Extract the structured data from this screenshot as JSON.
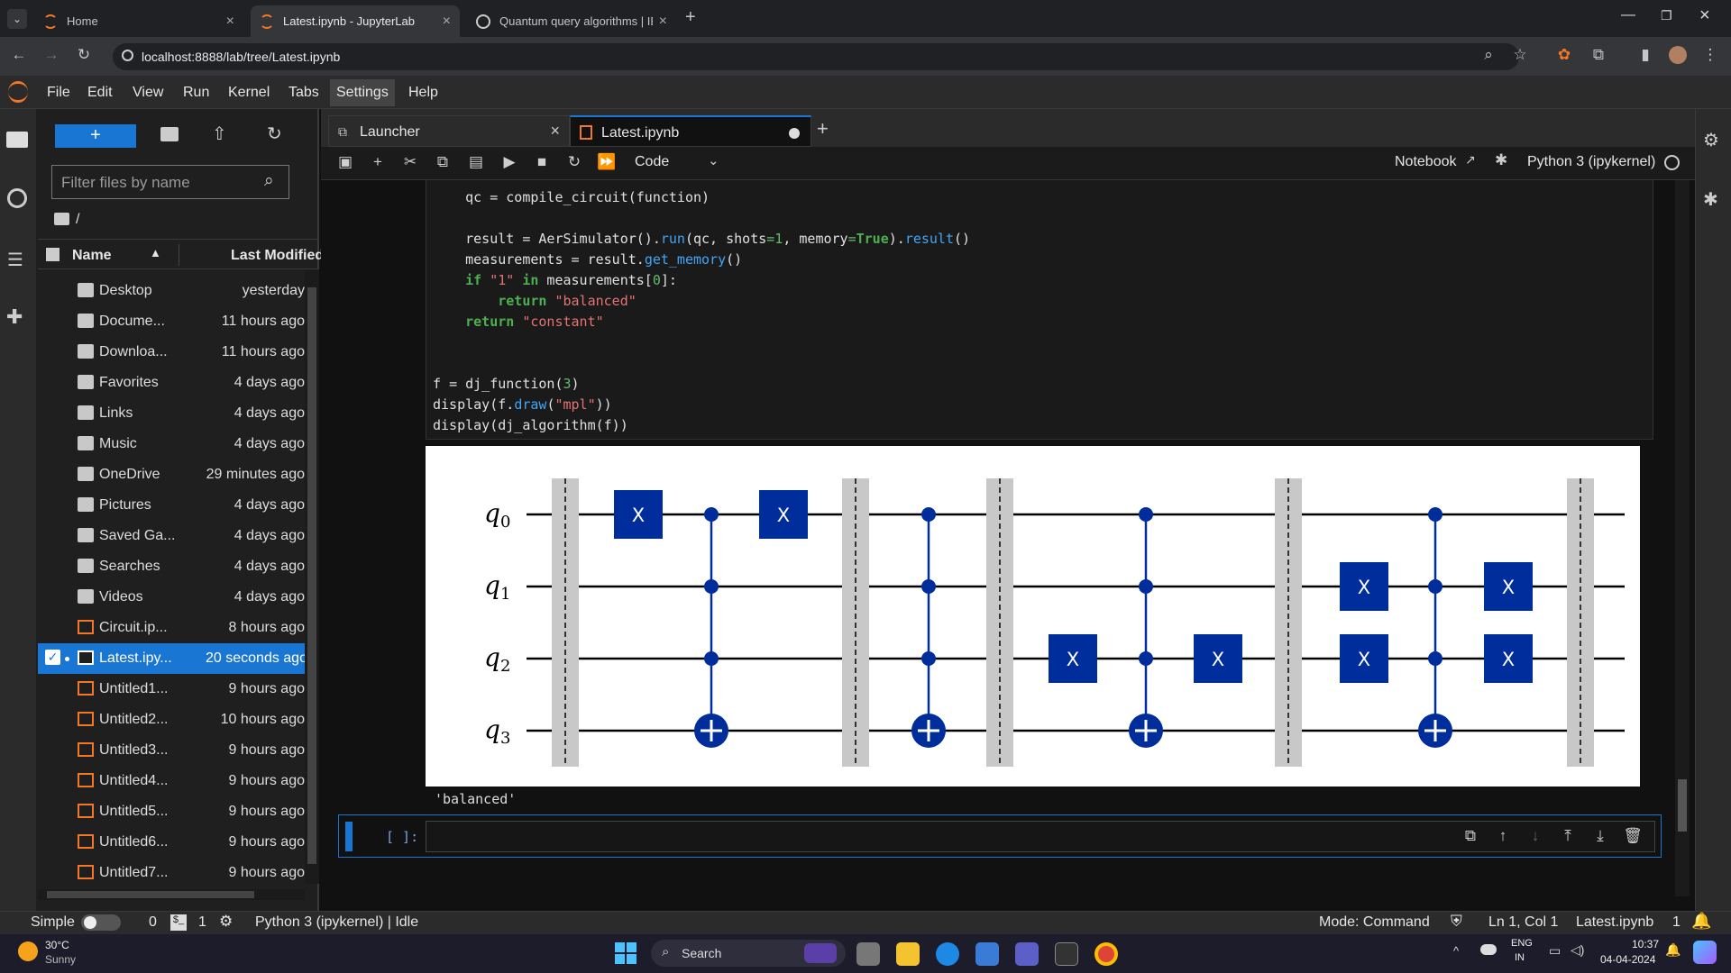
{
  "browser": {
    "tabs": [
      {
        "label": "Home"
      },
      {
        "label": "Latest.ipynb - JupyterLab"
      },
      {
        "label": "Quantum query algorithms | IBM"
      }
    ],
    "url": "localhost:8888/lab/tree/Latest.ipynb"
  },
  "menu": [
    "File",
    "Edit",
    "View",
    "Run",
    "Kernel",
    "Tabs",
    "Settings",
    "Help"
  ],
  "filebrowser": {
    "filter_placeholder": "Filter files by name",
    "path": "/",
    "col_name": "Name",
    "col_modified": "Last Modified",
    "files": [
      {
        "name": "Desktop",
        "modified": "yesterday",
        "type": "folder"
      },
      {
        "name": "Docume...",
        "modified": "11 hours ago",
        "type": "folder"
      },
      {
        "name": "Downloa...",
        "modified": "11 hours ago",
        "type": "folder"
      },
      {
        "name": "Favorites",
        "modified": "4 days ago",
        "type": "folder"
      },
      {
        "name": "Links",
        "modified": "4 days ago",
        "type": "folder"
      },
      {
        "name": "Music",
        "modified": "4 days ago",
        "type": "folder"
      },
      {
        "name": "OneDrive",
        "modified": "29 minutes ago",
        "type": "folder"
      },
      {
        "name": "Pictures",
        "modified": "4 days ago",
        "type": "folder"
      },
      {
        "name": "Saved Ga...",
        "modified": "4 days ago",
        "type": "folder"
      },
      {
        "name": "Searches",
        "modified": "4 days ago",
        "type": "folder"
      },
      {
        "name": "Videos",
        "modified": "4 days ago",
        "type": "folder"
      },
      {
        "name": "Circuit.ip...",
        "modified": "8 hours ago",
        "type": "notebook"
      },
      {
        "name": "Latest.ipy...",
        "modified": "20 seconds ago",
        "type": "notebook",
        "selected": true
      },
      {
        "name": "Untitled1...",
        "modified": "9 hours ago",
        "type": "notebook"
      },
      {
        "name": "Untitled2...",
        "modified": "10 hours ago",
        "type": "notebook"
      },
      {
        "name": "Untitled3...",
        "modified": "9 hours ago",
        "type": "notebook"
      },
      {
        "name": "Untitled4...",
        "modified": "9 hours ago",
        "type": "notebook"
      },
      {
        "name": "Untitled5...",
        "modified": "9 hours ago",
        "type": "notebook"
      },
      {
        "name": "Untitled6...",
        "modified": "9 hours ago",
        "type": "notebook"
      },
      {
        "name": "Untitled7...",
        "modified": "9 hours ago",
        "type": "notebook"
      }
    ]
  },
  "notebook": {
    "tabs": [
      {
        "label": "Launcher"
      },
      {
        "label": "Latest.ipynb"
      }
    ],
    "cell_type": "Code",
    "mode_label": "Notebook",
    "kernel": "Python 3 (ipykernel)",
    "output_text": "'balanced'",
    "empty_prompt": "[ ]:",
    "qubit_labels": [
      "q",
      "q",
      "q",
      "q"
    ],
    "qubit_subs": [
      "0",
      "1",
      "2",
      "3"
    ],
    "gate_label": "X"
  },
  "status": {
    "simple": "Simple",
    "n0": "0",
    "n1": "1",
    "kernel_state": "Python 3 (ipykernel) | Idle",
    "mode": "Mode: Command",
    "cursor": "Ln 1, Col 1",
    "file": "Latest.ipynb",
    "notif": "1"
  },
  "taskbar": {
    "temp": "30°C",
    "weather": "Sunny",
    "search": "Search",
    "lang1": "ENG",
    "lang2": "IN",
    "time": "10:37",
    "date": "04-04-2024"
  },
  "colors": {
    "accent": "#1976d2",
    "gate": "#002d9c",
    "orange": "#f37726"
  }
}
